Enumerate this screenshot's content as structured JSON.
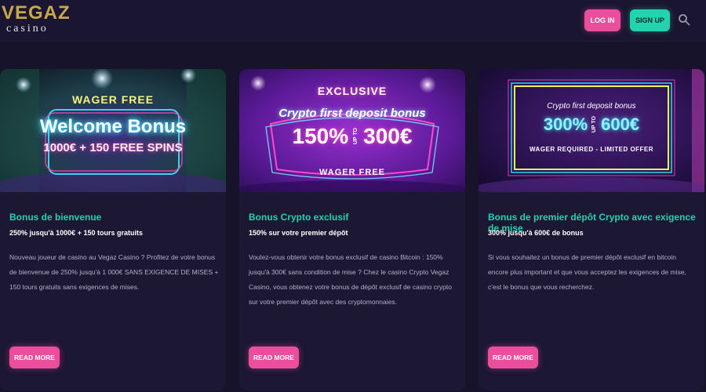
{
  "header": {
    "logo_main": "VEGAZ",
    "logo_sub": "casino",
    "login_label": "LOG IN",
    "signup_label": "SIGN UP",
    "search_icon": "search-icon"
  },
  "colors": {
    "background": "#17132a",
    "card": "#1c1733",
    "accent_pink": "#ec4e9e",
    "accent_teal": "#22d3b0",
    "logo_gold": "#c9a84c"
  },
  "cards": [
    {
      "banner": {
        "tag": "WAGER FREE",
        "headline": "Welcome Bonus",
        "subline": "1000€ + 150 FREE SPINS"
      },
      "title": "Bonus de bienvenue",
      "subtitle": "250% jusqu'à 1000€ + 150 tours gratuits",
      "description": "Nouveau joueur de casino au Vegaz Casino ? Profitez de votre bonus de bienvenue de 250% jusqu'à 1 000€ SANS EXIGENCE DE MISES + 150 tours gratuits sans exigences de mises.",
      "button": "READ MORE"
    },
    {
      "banner": {
        "tag": "EXCLUSIVE",
        "headline": "Crypto first deposit bonus",
        "percent": "150%",
        "upto": "UP TO",
        "amount": "300€",
        "footer": "WAGER FREE"
      },
      "title": "Bonus Crypto exclusif",
      "subtitle": "150% sur votre premier dépôt",
      "description": "Voulez-vous obtenir votre bonus exclusif de casino Bitcoin : 150% jusqu'à 300€ sans condition de mise ? Chez le casino Crypto Vegaz Casino, vous obtenez votre bonus de dépôt exclusif de casino crypto sur votre premier dépôt avec des cryptomonnaies.",
      "button": "READ MORE"
    },
    {
      "banner": {
        "headline": "Crypto first deposit bonus",
        "percent": "300%",
        "upto": "UP TO",
        "amount": "600€",
        "footer": "WAGER REQUIRED - LIMITED OFFER"
      },
      "title": "Bonus de premier dépôt Crypto avec exigence de mise",
      "subtitle": "300% jusqu'à 600€ de bonus",
      "description": "Si vous souhaitez un bonus de premier dépôt exclusif en bitcoin encore plus important et que vous acceptez les exigences de mise, c'est le bonus que vous recherchez.",
      "button": "READ MORE"
    }
  ]
}
